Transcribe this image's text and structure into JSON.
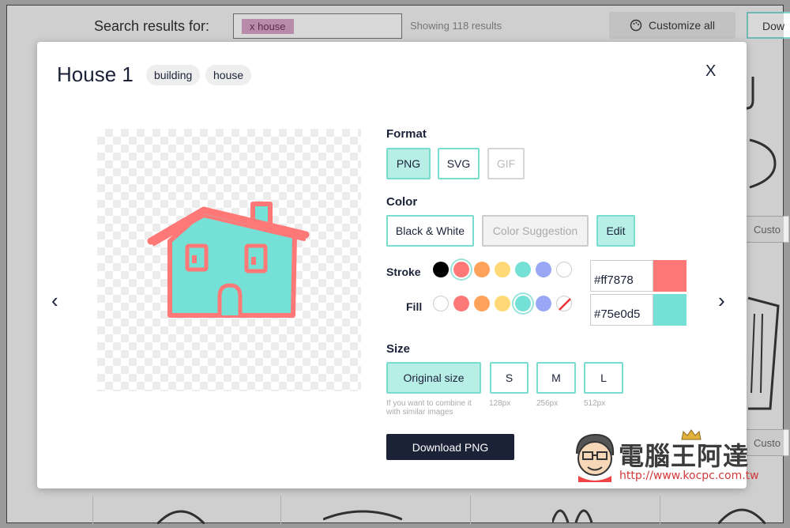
{
  "background": {
    "search_label": "Search results for:",
    "search_chip": "x house",
    "showing": "Showing 118 results",
    "customize_all": "Customize all",
    "download_partial": "Dow",
    "customize_partial": "Custo"
  },
  "modal": {
    "title": "House 1",
    "tags": [
      "building",
      "house"
    ],
    "close_label": "X",
    "prev_label": "‹",
    "next_label": "›",
    "format": {
      "label": "Format",
      "options": [
        "PNG",
        "SVG",
        "GIF"
      ],
      "selected": "PNG"
    },
    "color": {
      "label": "Color",
      "options": [
        "Black & White",
        "Color Suggestion",
        "Edit"
      ],
      "selected": "Edit",
      "stroke_label": "Stroke",
      "fill_label": "Fill",
      "stroke_swatches": [
        "#000000",
        "#ff7878",
        "#ffa25c",
        "#ffd976",
        "#75e0d5",
        "#9aa7f5",
        "#ffffff"
      ],
      "fill_swatches": [
        "#ffffff",
        "#ff7878",
        "#ffa25c",
        "#ffd976",
        "#75e0d5",
        "#9aa7f5",
        "none"
      ],
      "stroke_hex": "#ff7878",
      "fill_hex": "#75e0d5"
    },
    "size": {
      "label": "Size",
      "options": [
        "Original size",
        "S",
        "M",
        "L"
      ],
      "notes": [
        "If you want to combine it with similar images",
        "128px",
        "256px",
        "512px"
      ],
      "selected": "Original size"
    },
    "download_label": "Download PNG"
  },
  "watermark": {
    "text": "電腦王阿達",
    "url": "http://www.kocpc.com.tw"
  }
}
